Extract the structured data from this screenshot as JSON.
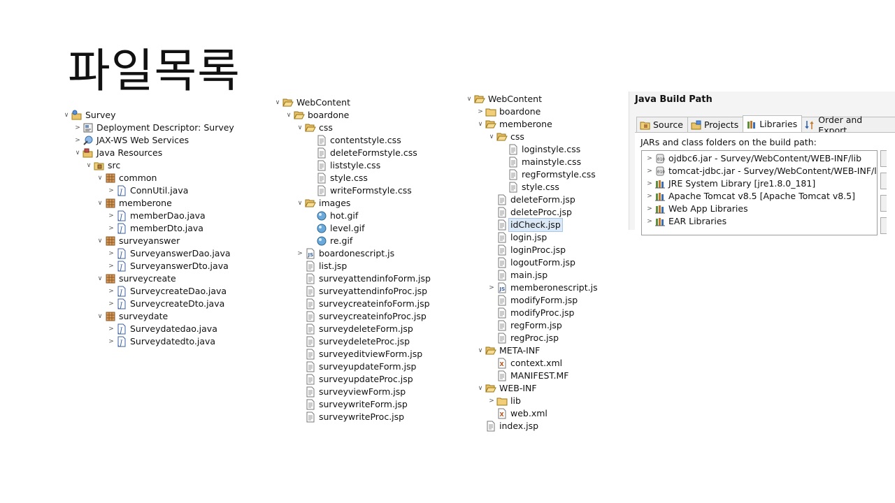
{
  "page_title": "파일목록",
  "tree1": [
    {
      "label": "Survey",
      "icon": "project",
      "twisty": "open",
      "indent": 0
    },
    {
      "label": "Deployment Descriptor: Survey",
      "icon": "deployment",
      "twisty": "closed",
      "indent": 1
    },
    {
      "label": "JAX-WS Web Services",
      "icon": "webservice",
      "twisty": "closed",
      "indent": 1
    },
    {
      "label": "Java Resources",
      "icon": "java-resources",
      "twisty": "open",
      "indent": 1
    },
    {
      "label": "src",
      "icon": "src-folder",
      "twisty": "open",
      "indent": 2
    },
    {
      "label": "common",
      "icon": "package",
      "twisty": "open",
      "indent": 3
    },
    {
      "label": "ConnUtil.java",
      "icon": "java-file",
      "twisty": "closed",
      "indent": 4
    },
    {
      "label": "memberone",
      "icon": "package",
      "twisty": "open",
      "indent": 3
    },
    {
      "label": "memberDao.java",
      "icon": "java-file",
      "twisty": "closed",
      "indent": 4
    },
    {
      "label": "memberDto.java",
      "icon": "java-file",
      "twisty": "closed",
      "indent": 4
    },
    {
      "label": "surveyanswer",
      "icon": "package",
      "twisty": "open",
      "indent": 3
    },
    {
      "label": "SurveyanswerDao.java",
      "icon": "java-file",
      "twisty": "closed",
      "indent": 4
    },
    {
      "label": "SurveyanswerDto.java",
      "icon": "java-file",
      "twisty": "closed",
      "indent": 4
    },
    {
      "label": "surveycreate",
      "icon": "package",
      "twisty": "open",
      "indent": 3
    },
    {
      "label": "SurveycreateDao.java",
      "icon": "java-file",
      "twisty": "closed",
      "indent": 4
    },
    {
      "label": "SurveycreateDto.java",
      "icon": "java-file",
      "twisty": "closed",
      "indent": 4
    },
    {
      "label": "surveydate",
      "icon": "package",
      "twisty": "open",
      "indent": 3
    },
    {
      "label": "Surveydatedao.java",
      "icon": "java-file",
      "twisty": "closed",
      "indent": 4
    },
    {
      "label": "Surveydatedto.java",
      "icon": "java-file",
      "twisty": "closed",
      "indent": 4
    }
  ],
  "tree2": [
    {
      "label": "WebContent",
      "icon": "folder-open",
      "twisty": "open",
      "indent": 0
    },
    {
      "label": "boardone",
      "icon": "folder-open",
      "twisty": "open",
      "indent": 1
    },
    {
      "label": "css",
      "icon": "folder-open",
      "twisty": "open",
      "indent": 2
    },
    {
      "label": "contentstyle.css",
      "icon": "text-file",
      "twisty": "none",
      "indent": 3
    },
    {
      "label": "deleteFormstyle.css",
      "icon": "text-file",
      "twisty": "none",
      "indent": 3
    },
    {
      "label": "liststyle.css",
      "icon": "text-file",
      "twisty": "none",
      "indent": 3
    },
    {
      "label": "style.css",
      "icon": "text-file",
      "twisty": "none",
      "indent": 3
    },
    {
      "label": "writeFormstyle.css",
      "icon": "text-file",
      "twisty": "none",
      "indent": 3
    },
    {
      "label": "images",
      "icon": "folder-open",
      "twisty": "open",
      "indent": 2
    },
    {
      "label": "hot.gif",
      "icon": "image-file",
      "twisty": "none",
      "indent": 3
    },
    {
      "label": "level.gif",
      "icon": "image-file",
      "twisty": "none",
      "indent": 3
    },
    {
      "label": "re.gif",
      "icon": "image-file",
      "twisty": "none",
      "indent": 3
    },
    {
      "label": "boardonescript.js",
      "icon": "js-file",
      "twisty": "closed",
      "indent": 2
    },
    {
      "label": "list.jsp",
      "icon": "text-file",
      "twisty": "none",
      "indent": 2
    },
    {
      "label": "surveyattendinfoForm.jsp",
      "icon": "text-file",
      "twisty": "none",
      "indent": 2
    },
    {
      "label": "surveyattendinfoProc.jsp",
      "icon": "text-file",
      "twisty": "none",
      "indent": 2
    },
    {
      "label": "surveycreateinfoForm.jsp",
      "icon": "text-file",
      "twisty": "none",
      "indent": 2
    },
    {
      "label": "surveycreateinfoProc.jsp",
      "icon": "text-file",
      "twisty": "none",
      "indent": 2
    },
    {
      "label": "surveydeleteForm.jsp",
      "icon": "text-file",
      "twisty": "none",
      "indent": 2
    },
    {
      "label": "surveydeleteProc.jsp",
      "icon": "text-file",
      "twisty": "none",
      "indent": 2
    },
    {
      "label": "surveyeditviewForm.jsp",
      "icon": "text-file",
      "twisty": "none",
      "indent": 2
    },
    {
      "label": "surveyupdateForm.jsp",
      "icon": "text-file",
      "twisty": "none",
      "indent": 2
    },
    {
      "label": "surveyupdateProc.jsp",
      "icon": "text-file",
      "twisty": "none",
      "indent": 2
    },
    {
      "label": "surveyviewForm.jsp",
      "icon": "text-file",
      "twisty": "none",
      "indent": 2
    },
    {
      "label": "surveywriteForm.jsp",
      "icon": "text-file",
      "twisty": "none",
      "indent": 2
    },
    {
      "label": "surveywriteProc.jsp",
      "icon": "text-file",
      "twisty": "none",
      "indent": 2
    }
  ],
  "tree3": [
    {
      "label": "WebContent",
      "icon": "folder-open",
      "twisty": "open",
      "indent": 0
    },
    {
      "label": "boardone",
      "icon": "folder",
      "twisty": "closed",
      "indent": 1
    },
    {
      "label": "memberone",
      "icon": "folder-open",
      "twisty": "open",
      "indent": 1
    },
    {
      "label": "css",
      "icon": "folder-open",
      "twisty": "open",
      "indent": 2
    },
    {
      "label": "loginstyle.css",
      "icon": "text-file",
      "twisty": "none",
      "indent": 3
    },
    {
      "label": "mainstyle.css",
      "icon": "text-file",
      "twisty": "none",
      "indent": 3
    },
    {
      "label": "regFormstyle.css",
      "icon": "text-file",
      "twisty": "none",
      "indent": 3
    },
    {
      "label": "style.css",
      "icon": "text-file",
      "twisty": "none",
      "indent": 3
    },
    {
      "label": "deleteForm.jsp",
      "icon": "text-file",
      "twisty": "none",
      "indent": 2
    },
    {
      "label": "deleteProc.jsp",
      "icon": "text-file",
      "twisty": "none",
      "indent": 2
    },
    {
      "label": "idCheck.jsp",
      "icon": "text-file",
      "twisty": "none",
      "indent": 2,
      "selected": true
    },
    {
      "label": "login.jsp",
      "icon": "text-file",
      "twisty": "none",
      "indent": 2
    },
    {
      "label": "loginProc.jsp",
      "icon": "text-file",
      "twisty": "none",
      "indent": 2
    },
    {
      "label": "logoutForm.jsp",
      "icon": "text-file",
      "twisty": "none",
      "indent": 2
    },
    {
      "label": "main.jsp",
      "icon": "text-file",
      "twisty": "none",
      "indent": 2
    },
    {
      "label": "memberonescript.js",
      "icon": "js-file",
      "twisty": "closed",
      "indent": 2
    },
    {
      "label": "modifyForm.jsp",
      "icon": "text-file",
      "twisty": "none",
      "indent": 2
    },
    {
      "label": "modifyProc.jsp",
      "icon": "text-file",
      "twisty": "none",
      "indent": 2
    },
    {
      "label": "regForm.jsp",
      "icon": "text-file",
      "twisty": "none",
      "indent": 2
    },
    {
      "label": "regProc.jsp",
      "icon": "text-file",
      "twisty": "none",
      "indent": 2
    },
    {
      "label": "META-INF",
      "icon": "folder-open",
      "twisty": "open",
      "indent": 1
    },
    {
      "label": "context.xml",
      "icon": "xml-file",
      "twisty": "none",
      "indent": 2
    },
    {
      "label": "MANIFEST.MF",
      "icon": "text-file",
      "twisty": "none",
      "indent": 2
    },
    {
      "label": "WEB-INF",
      "icon": "folder-open",
      "twisty": "open",
      "indent": 1
    },
    {
      "label": "lib",
      "icon": "folder",
      "twisty": "closed",
      "indent": 2
    },
    {
      "label": "web.xml",
      "icon": "xml-file",
      "twisty": "none",
      "indent": 2
    },
    {
      "label": "index.jsp",
      "icon": "text-file",
      "twisty": "none",
      "indent": 1
    }
  ],
  "build_path": {
    "title": "Java Build Path",
    "tabs": [
      {
        "label": "Source",
        "icon": "source-folder-icon",
        "active": false
      },
      {
        "label": "Projects",
        "icon": "projects-icon",
        "active": false
      },
      {
        "label": "Libraries",
        "icon": "libraries-icon",
        "active": true
      },
      {
        "label": "Order and Export",
        "icon": "order-export-icon",
        "active": false
      }
    ],
    "description": "JARs and class folders on the build path:",
    "entries": [
      {
        "label": "ojdbc6.jar - Survey/WebContent/WEB-INF/lib",
        "icon": "jar"
      },
      {
        "label": "tomcat-jdbc.jar - Survey/WebContent/WEB-INF/lib",
        "icon": "jar"
      },
      {
        "label": "JRE System Library [jre1.8.0_181]",
        "icon": "library"
      },
      {
        "label": "Apache Tomcat v8.5 [Apache Tomcat v8.5]",
        "icon": "library"
      },
      {
        "label": "Web App Libraries",
        "icon": "library"
      },
      {
        "label": "EAR Libraries",
        "icon": "library"
      }
    ]
  }
}
